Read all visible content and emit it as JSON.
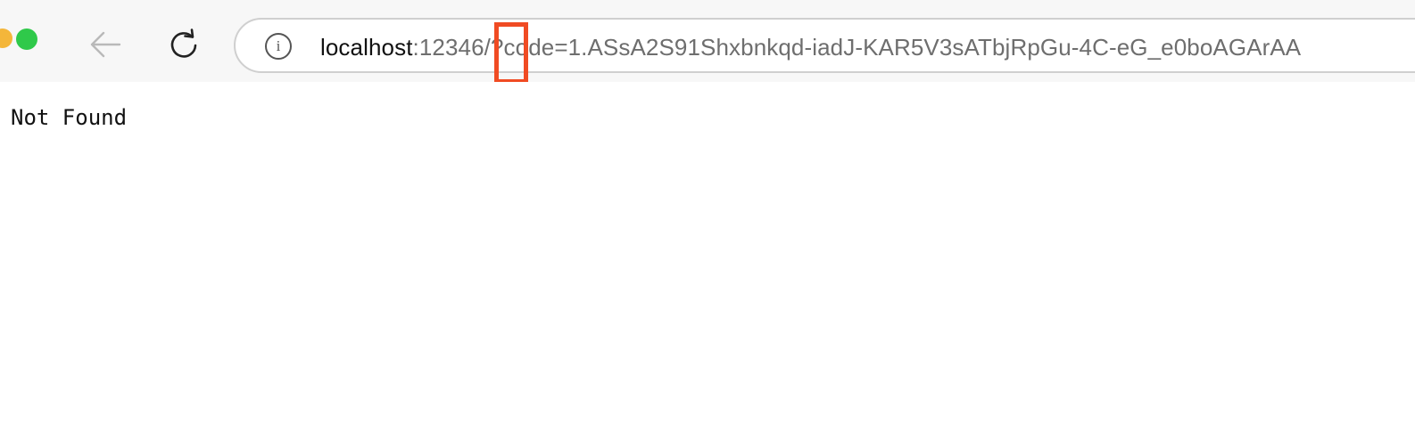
{
  "browser": {
    "url_host": "localhost",
    "url_rest": ":12346/?code=1.ASsA2S91Shxbnkqd-iadJ-KAR5V3sATbjRpGu-4C-eG_e0boAGArAA",
    "info_symbol": "i"
  },
  "page": {
    "message": "Not Found"
  },
  "colors": {
    "highlight": "#f04b23",
    "traffic_green": "#2fc94a",
    "traffic_yellow": "#f4b63a"
  }
}
